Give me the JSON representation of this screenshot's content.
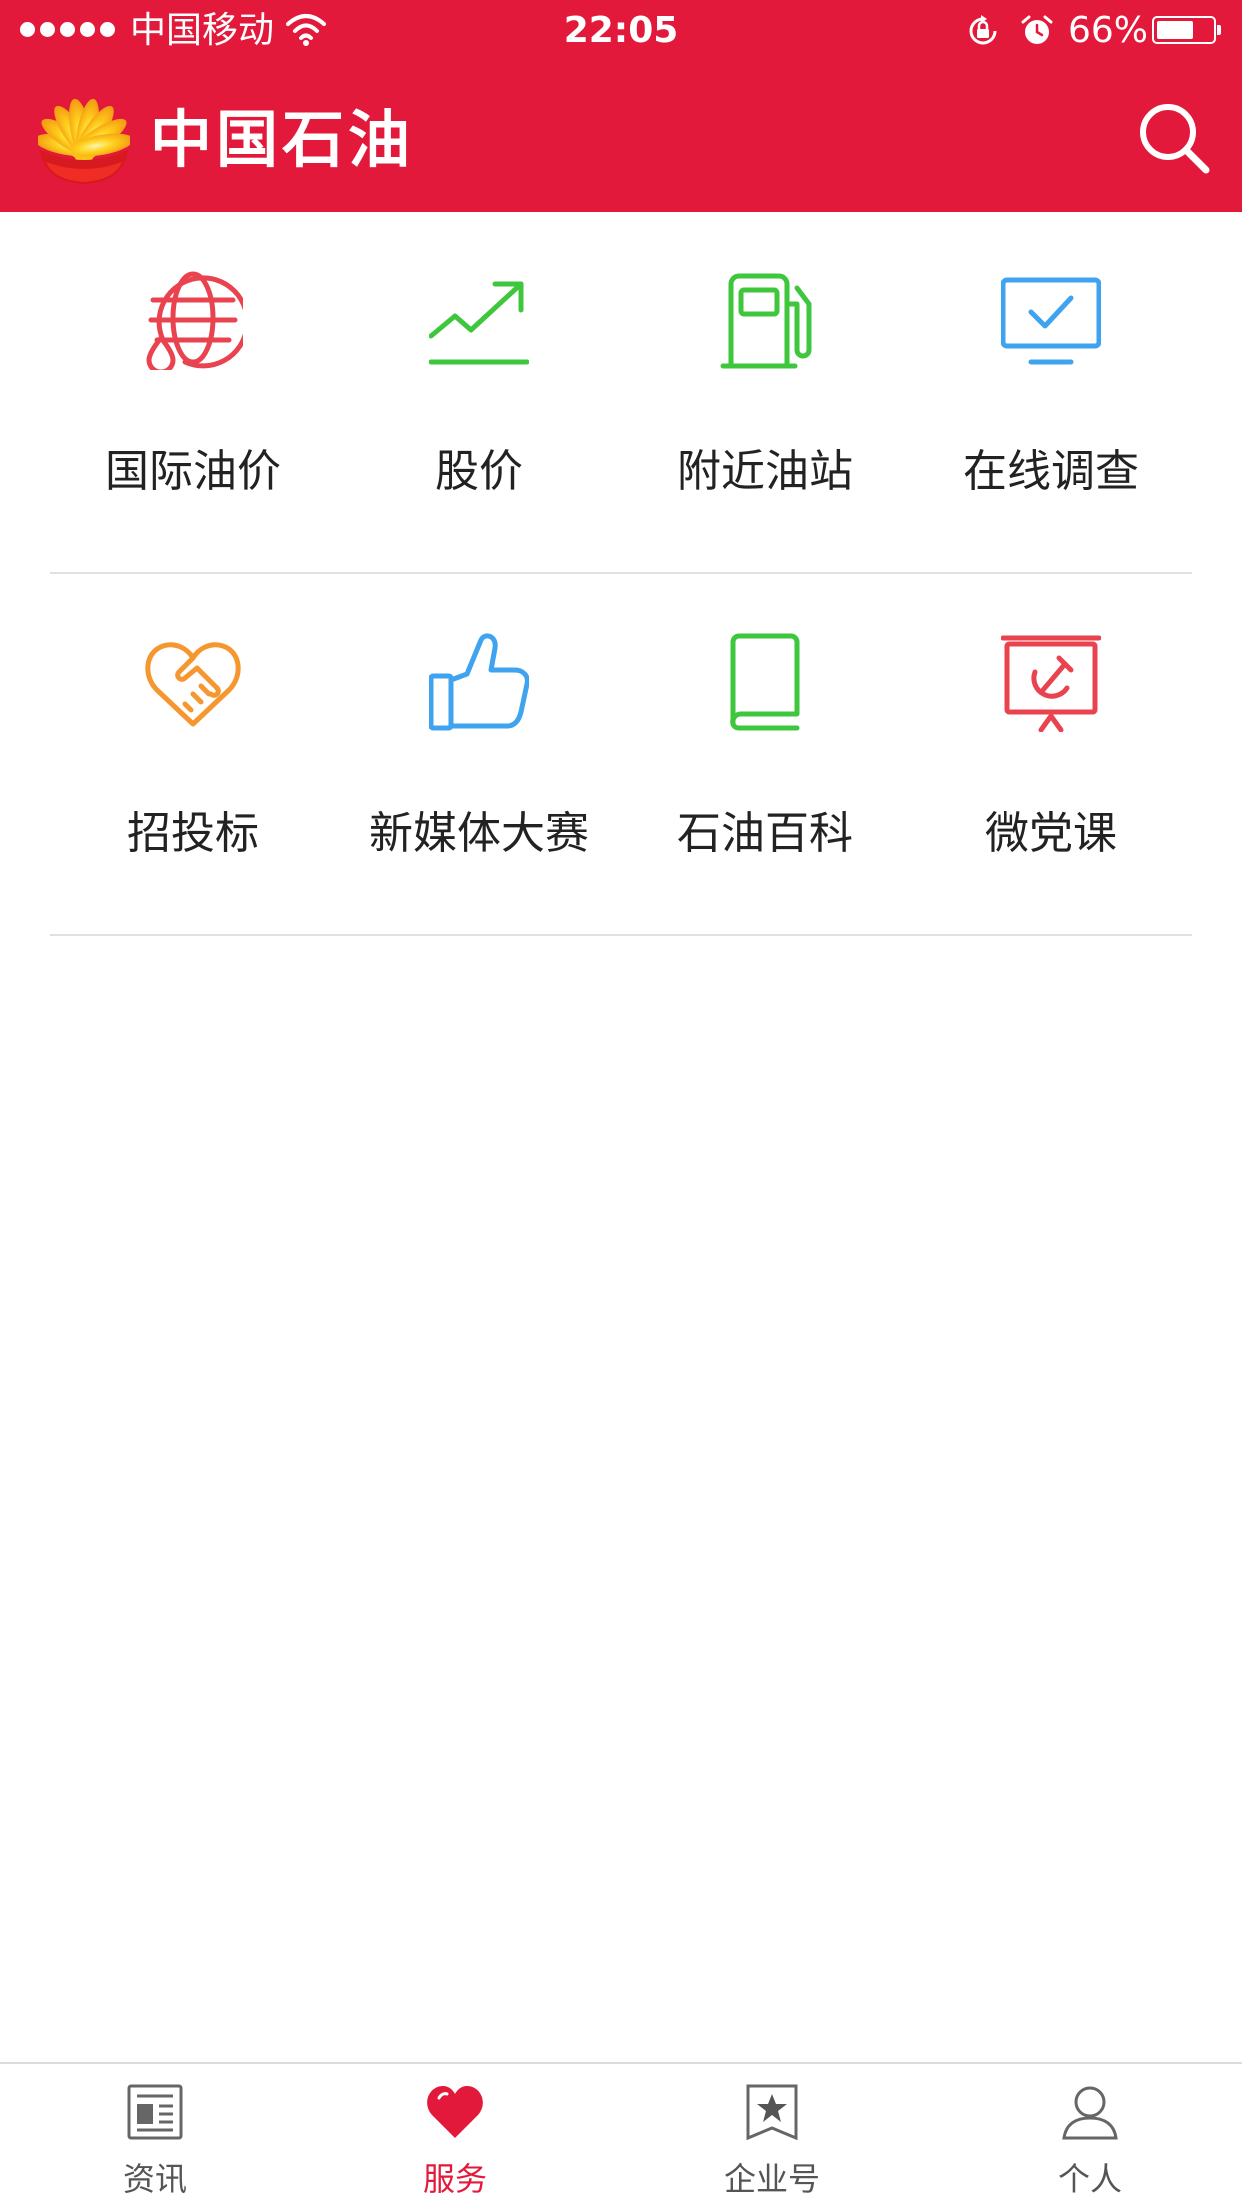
{
  "status_bar": {
    "carrier": "中国移动",
    "time": "22:05",
    "battery_percent": "66%",
    "battery_level": 0.66,
    "signal_bars": 5
  },
  "header": {
    "brand": "中国石油",
    "logo_icon": "petrochina-logo",
    "search_icon": "search-icon",
    "color": "#e2193a"
  },
  "services": [
    {
      "label": "国际油价",
      "icon": "globe-oil-drop-icon",
      "color": "#e8434f"
    },
    {
      "label": "股价",
      "icon": "trend-chart-icon",
      "color": "#3ec63c"
    },
    {
      "label": "附近油站",
      "icon": "fuel-pump-icon",
      "color": "#3ec63c"
    },
    {
      "label": "在线调查",
      "icon": "monitor-check-icon",
      "color": "#3fa3ef"
    },
    {
      "label": "招投标",
      "icon": "handshake-icon",
      "color": "#f5962e"
    },
    {
      "label": "新媒体大赛",
      "icon": "thumbs-up-icon",
      "color": "#3fa3ef"
    },
    {
      "label": "石油百科",
      "icon": "book-icon",
      "color": "#3ec63c"
    },
    {
      "label": "微党课",
      "icon": "presentation-hammer-sickle-icon",
      "color": "#e8434f"
    }
  ],
  "tabs": [
    {
      "label": "资讯",
      "icon": "newspaper-icon"
    },
    {
      "label": "服务",
      "icon": "heart-icon"
    },
    {
      "label": "企业号",
      "icon": "star-bookmark-icon"
    },
    {
      "label": "个人",
      "icon": "user-icon"
    }
  ],
  "active_tab": "服务"
}
